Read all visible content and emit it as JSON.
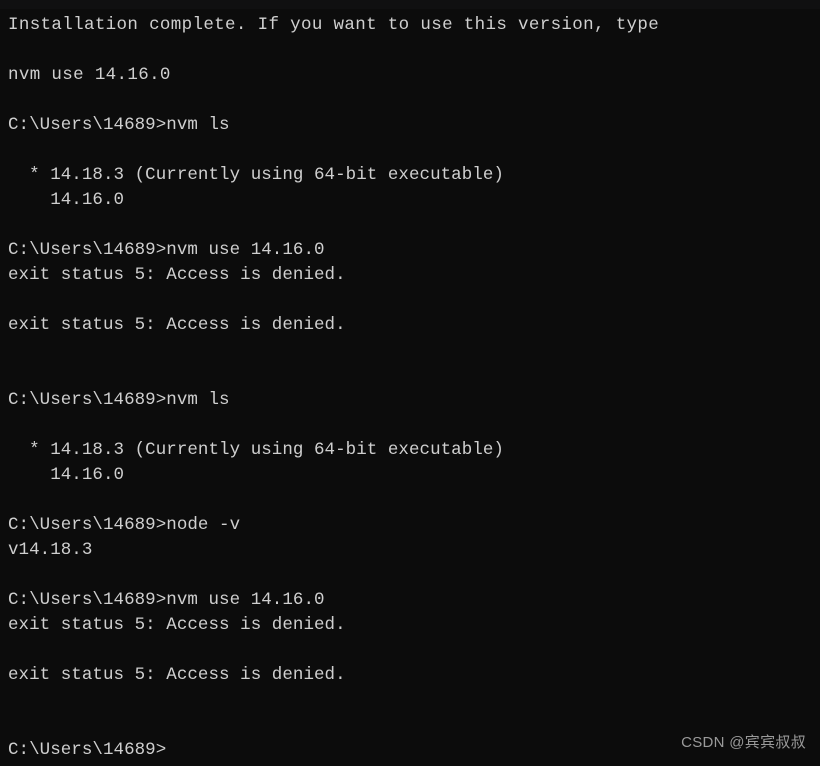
{
  "window": {
    "type": "windows-command-prompt",
    "background_color": "#0c0c0c",
    "text_color": "#cfcfcf"
  },
  "prompt": "C:\\Users\\14689>",
  "terminal": {
    "lines": [
      "Installation complete. If you want to use this version, type",
      "",
      "nvm use 14.16.0",
      "",
      "C:\\Users\\14689>nvm ls",
      "",
      "  * 14.18.3 (Currently using 64-bit executable)",
      "    14.16.0",
      "",
      "C:\\Users\\14689>nvm use 14.16.0",
      "exit status 5: Access is denied.",
      "",
      "exit status 5: Access is denied.",
      "",
      "",
      "C:\\Users\\14689>nvm ls",
      "",
      "  * 14.18.3 (Currently using 64-bit executable)",
      "    14.16.0",
      "",
      "C:\\Users\\14689>node -v",
      "v14.18.3",
      "",
      "C:\\Users\\14689>nvm use 14.16.0",
      "exit status 5: Access is denied.",
      "",
      "exit status 5: Access is denied.",
      "",
      "",
      "C:\\Users\\14689>"
    ]
  },
  "watermark": {
    "text": "CSDN @宾宾叔叔",
    "color": "#9a9a9a"
  }
}
